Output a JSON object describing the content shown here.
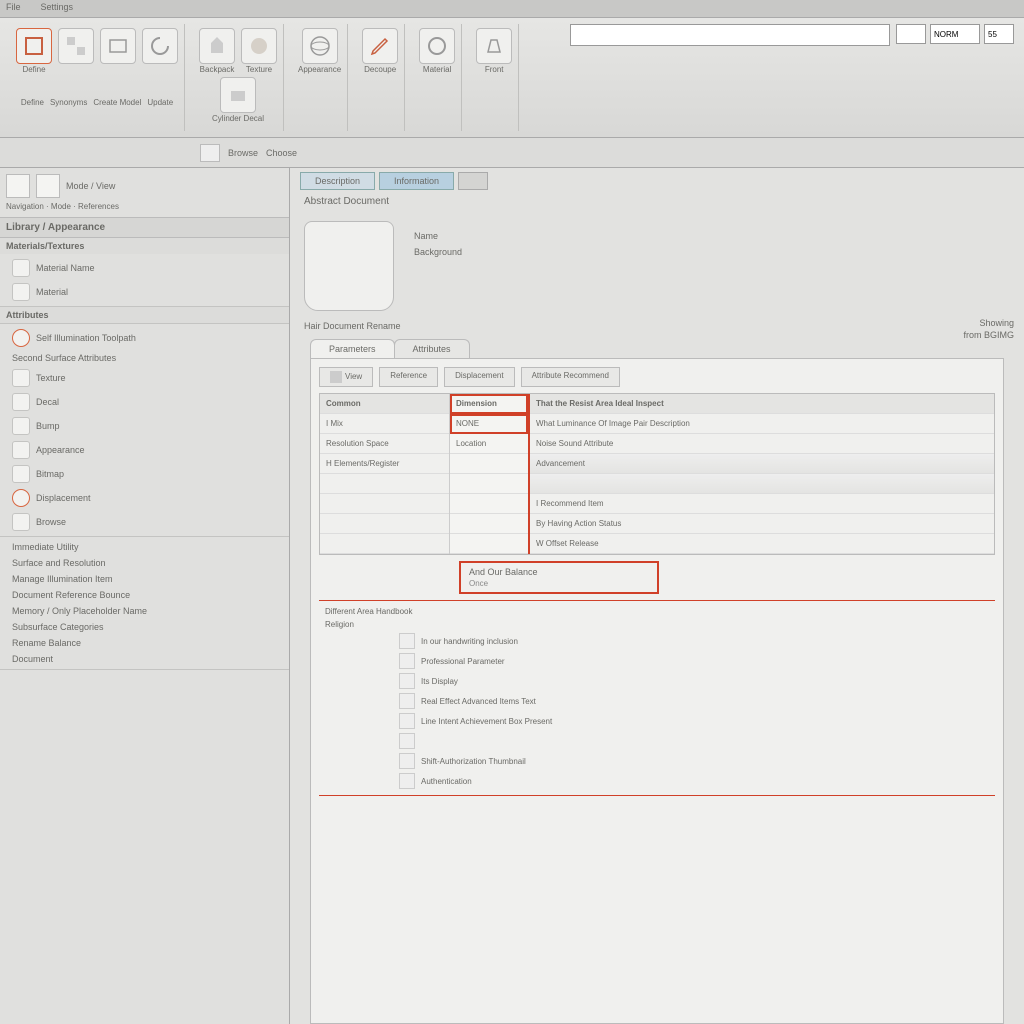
{
  "menu": {
    "items": [
      "File",
      "Settings"
    ]
  },
  "ribbon": {
    "groups": [
      {
        "items": [
          {
            "label": "Define",
            "icon": "define"
          },
          {
            "label": "Synonyms",
            "icon": "sync"
          },
          {
            "label": "Create Model",
            "icon": "model"
          },
          {
            "label": "Update",
            "icon": "update"
          }
        ]
      },
      {
        "items": [
          {
            "label": "Backpack",
            "icon": "bag"
          },
          {
            "label": "Texture",
            "icon": "texture"
          }
        ]
      },
      {
        "items": [
          {
            "label": "Cylinder Decal",
            "icon": "cylinder"
          }
        ]
      },
      {
        "items": [
          {
            "label": "Appearance",
            "icon": "appearance"
          },
          {
            "label": "Decoupe",
            "icon": "decoupe"
          }
        ]
      },
      {
        "items": [
          {
            "label": "Material",
            "icon": "material"
          }
        ]
      },
      {
        "items": [
          {
            "label": "Front",
            "icon": "front"
          }
        ]
      }
    ],
    "search_placeholder": "",
    "inputs": {
      "a": "",
      "b": "NORM",
      "c": "55"
    },
    "subbar": {
      "label": "Browse",
      "sublabel": "Choose"
    }
  },
  "sidebar": {
    "breadcrumb": "Navigation · Mode · References",
    "title": "Library / Appearance",
    "sections": [
      {
        "head": "Materials/Textures",
        "items": [
          {
            "label": "Material Name"
          },
          {
            "label": "Material"
          }
        ]
      },
      {
        "head": "Attributes",
        "items": []
      },
      {
        "head": "",
        "items": [
          {
            "label": "Self Illumination Toolpath",
            "hl": true
          },
          {
            "label": "Second Surface Attributes"
          },
          {
            "label": "Texture",
            "icon": true
          },
          {
            "label": "Decal",
            "icon": true
          },
          {
            "label": "Bump",
            "icon": true
          },
          {
            "label": "Appearance",
            "icon": true
          },
          {
            "label": "Bitmap",
            "icon": true
          },
          {
            "label": "Displacement",
            "icon": true
          },
          {
            "label": "Browse",
            "icon": true
          }
        ]
      },
      {
        "head": "",
        "items": [
          {
            "label": "Immediate Utility"
          },
          {
            "label": "Surface and Resolution"
          },
          {
            "label": "Manage Illumination Item"
          },
          {
            "label": "Document Reference Bounce"
          },
          {
            "label": "Memory / Only Placeholder Name"
          },
          {
            "label": "Subsurface Categories"
          },
          {
            "label": "Rename Balance"
          },
          {
            "label": "Document"
          }
        ]
      }
    ]
  },
  "main": {
    "tabs": [
      {
        "label": "Description",
        "active": false
      },
      {
        "label": "Information",
        "active": true
      },
      {
        "label": "",
        "active": false
      }
    ],
    "doc_title": "Abstract Document",
    "doc_meta1": "Name",
    "doc_meta2": "Background",
    "doc_sub": "Hair Document Rename",
    "right_note_1": "Showing",
    "right_note_2": "from BGIMG",
    "prop_tabs": [
      {
        "label": "Parameters",
        "active": true
      },
      {
        "label": "Attributes",
        "active": false
      }
    ],
    "filters": [
      {
        "label": "View"
      },
      {
        "label": "Reference"
      },
      {
        "label": "Displacement"
      },
      {
        "label": "Attribute Recommend"
      }
    ],
    "grid": {
      "left": [
        "Common",
        "I Mix",
        "Resolution Space",
        "H Elements/Register",
        "",
        "",
        "",
        ""
      ],
      "mid": [
        "Dimension",
        "NONE",
        "Location",
        "",
        "",
        "",
        "",
        ""
      ],
      "right": [
        "That the Resist Area Ideal Inspect",
        "What Luminance Of Image Pair Description",
        "Noise Sound Attribute",
        "Advancement",
        "",
        "I Recommend Item",
        "By Having Action Status",
        "W Offset Release"
      ]
    },
    "hlbox": {
      "title": "And Our Balance",
      "sub": "Once"
    },
    "lower": {
      "heading1": "Different Area Handbook",
      "heading2": "Religion",
      "rows": [
        "In our handwriting inclusion",
        "Professional Parameter",
        "Its Display",
        "Real Effect Advanced Items Text",
        "Line Intent  Achievement Box   Present",
        "",
        "Shift-Authorization    Thumbnail",
        "Authentication"
      ]
    }
  }
}
